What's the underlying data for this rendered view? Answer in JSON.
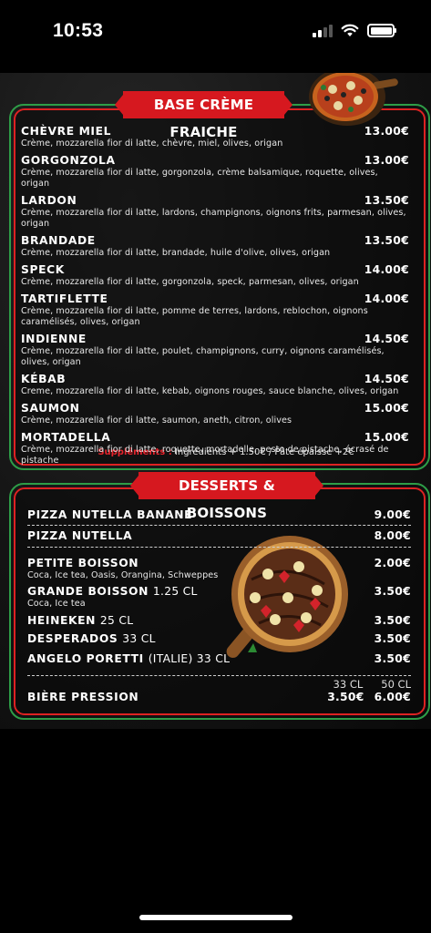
{
  "status_bar": {
    "time": "10:53"
  },
  "section1": {
    "title": "BASE CRÈME FRAICHE",
    "items": [
      {
        "name": "CHÈVRE MIEL",
        "price": "13.00€",
        "desc": "Crème, mozzarella fior di latte, chèvre, miel, olives, origan"
      },
      {
        "name": "GORGONZOLA",
        "price": "13.00€",
        "desc": "Crème, mozzarella fior di latte, gorgonzola, crème balsamique, roquette, olives, origan"
      },
      {
        "name": "LARDON",
        "price": "13.50€",
        "desc": "Crème, mozzarella fior di latte, lardons, champignons, oignons frits, parmesan, olives, origan"
      },
      {
        "name": "BRANDADE",
        "price": "13.50€",
        "desc": "Crème, mozzarella fior di latte, brandade, huile d'olive, olives, origan"
      },
      {
        "name": "SPECK",
        "price": "14.00€",
        "desc": "Crème, mozzarella fior di latte, gorgonzola, speck, parmesan, olives, origan"
      },
      {
        "name": "TARTIFLETTE",
        "price": "14.00€",
        "desc": "Crème, mozzarella fior di latte, pomme de terres, lardons, reblochon, oignons caramélisés, olives, origan"
      },
      {
        "name": "INDIENNE",
        "price": "14.50€",
        "desc": "Crème, mozzarella fior di latte, poulet, champignons, curry, oignons caramélisés, olives, origan"
      },
      {
        "name": "KÉBAB",
        "price": "14.50€",
        "desc": "Creme, mozzarella fior di latte, kebab, oignons rouges, sauce blanche, olives, origan"
      },
      {
        "name": "SAUMON",
        "price": "15.00€",
        "desc": "Crème, mozzarella fior di latte, saumon, aneth, citron, olives"
      },
      {
        "name": "MORTADELLA",
        "price": "15.00€",
        "desc": "Crème, mozzarella fior di latte, roquette, mortadelle, pesto de pistache, écrasé de pistache"
      }
    ],
    "supplements_label": "Suppléments :",
    "supplements_text": "Ingrédients + 1.50€ / Pâte épaisse +2€"
  },
  "section2": {
    "title": "DESSERTS & BOISSONS",
    "rows": [
      {
        "name": "PIZZA NUTELLA BANANE",
        "vol": "",
        "price": "9.00€",
        "sub": ""
      },
      {
        "name": "PIZZA NUTELLA",
        "vol": "",
        "price": "8.00€",
        "sub": ""
      },
      {
        "name": "PETITE BOISSON",
        "vol": "",
        "price": "2.00€",
        "sub": "Coca, Ice tea, Oasis, Orangina, Schweppes"
      },
      {
        "name": "GRANDE BOISSON",
        "vol": "1.25 CL",
        "price": "3.50€",
        "sub": "Coca,  Ice tea"
      },
      {
        "name": "HEINEKEN",
        "vol": "25 CL",
        "price": "3.50€",
        "sub": ""
      },
      {
        "name": "DESPERADOS",
        "vol": "33 CL",
        "price": "3.50€",
        "sub": ""
      },
      {
        "name": "ANGELO PORETTI",
        "vol": "(ITALIE) 33 CL",
        "price": "3.50€",
        "sub": ""
      }
    ],
    "beer": {
      "header_small": "33 CL",
      "header_large": "50 CL",
      "name": "BIÈRE PRESSION",
      "price_small": "3.50€",
      "price_large": "6.00€"
    }
  }
}
